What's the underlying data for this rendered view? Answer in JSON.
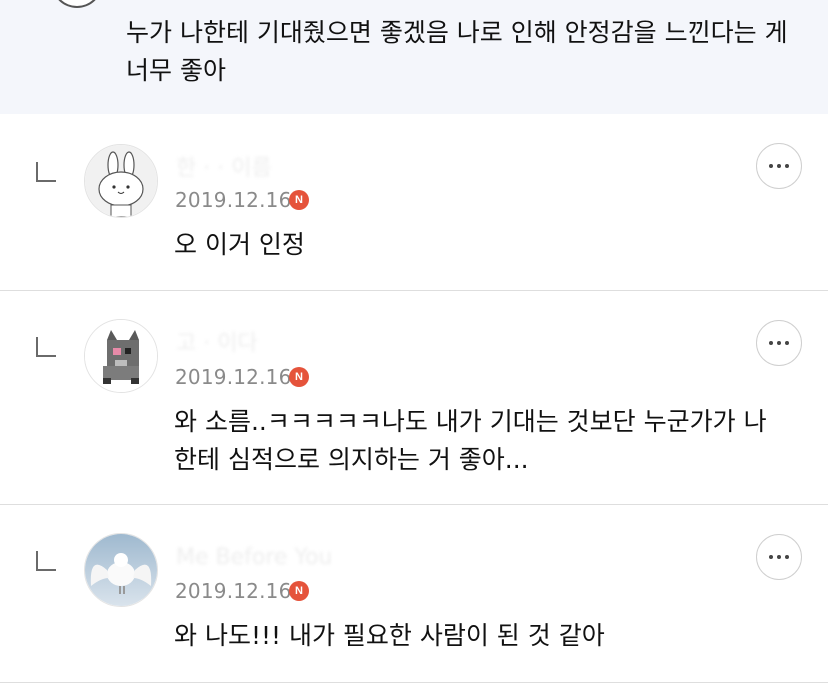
{
  "parent_comment": {
    "text": "누가 나한테 기대줬으면 좋겠음 나로 인해 안정감을 느낀다는 게 너무 좋아"
  },
  "replies": [
    {
      "author": "한 · · 이름",
      "date": "2019.12.16",
      "badge": "N",
      "avatar": "rabbit-avatar",
      "text": "오 이거 인정"
    },
    {
      "author": "고 · 이다",
      "date": "2019.12.16",
      "badge": "N",
      "avatar": "cat-avatar",
      "text": "와 소름..ㅋㅋㅋㅋㅋ나도 내가 기대는 것보단 누군가가 나한테 심적으로 의지하는 거 좋아..."
    },
    {
      "author": "Me Before You",
      "date": "2019.12.16",
      "badge": "N",
      "avatar": "bird-avatar",
      "text": "와 나도!!! 내가 필요한 사람이 된 것 같아"
    }
  ],
  "icons": {
    "more": "more-options-icon",
    "reply": "reply-arrow-icon"
  },
  "colors": {
    "parent_background": "#f4f6fb",
    "badge": "#e5533b",
    "date": "#8a8a8a"
  }
}
